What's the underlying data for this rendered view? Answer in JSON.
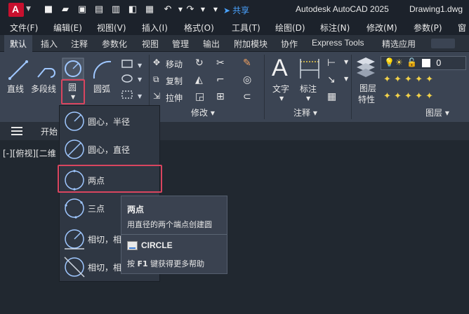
{
  "titlebar": {
    "logo_letter": "A",
    "share_label": "共享",
    "app_title": "Autodesk AutoCAD 2025",
    "doc_title": "Drawing1.dwg"
  },
  "menu": [
    "文件(F)",
    "编辑(E)",
    "视图(V)",
    "插入(I)",
    "格式(O)",
    "工具(T)",
    "绘图(D)",
    "标注(N)",
    "修改(M)",
    "参数(P)",
    "窗"
  ],
  "tabs": [
    "默认",
    "插入",
    "注释",
    "参数化",
    "视图",
    "管理",
    "输出",
    "附加模块",
    "协作",
    "Express Tools",
    "精选应用"
  ],
  "ribbon": {
    "draw": {
      "line": "直线",
      "polyline": "多段线",
      "circle": "圆",
      "arc": "圆弧"
    },
    "modify": {
      "move": "移动",
      "copy": "复制",
      "stretch": "拉伸",
      "label": "修改"
    },
    "annotation": {
      "text": "文字",
      "dimension": "标注",
      "label": "注释"
    },
    "layers": {
      "props": "图层特性",
      "props_line1": "图层",
      "props_line2": "特性",
      "label": "图层",
      "layer_value": "0"
    }
  },
  "doc": {
    "tab": "开始",
    "viewport": "[-][俯视][二维"
  },
  "circle_menu": {
    "items": [
      "圆心，半径",
      "圆心，直径",
      "两点",
      "三点",
      "相切，相",
      "相切，相"
    ]
  },
  "tooltip": {
    "title": "两点",
    "description": "用直径的两个端点创建圆",
    "command": "CIRCLE",
    "help_prefix": "按",
    "help_key": "F1",
    "help_suffix": "键获得更多帮助"
  },
  "colors": {
    "highlight": "#d9455f",
    "accent": "#4aa3ff",
    "logo": "#c8102e"
  }
}
